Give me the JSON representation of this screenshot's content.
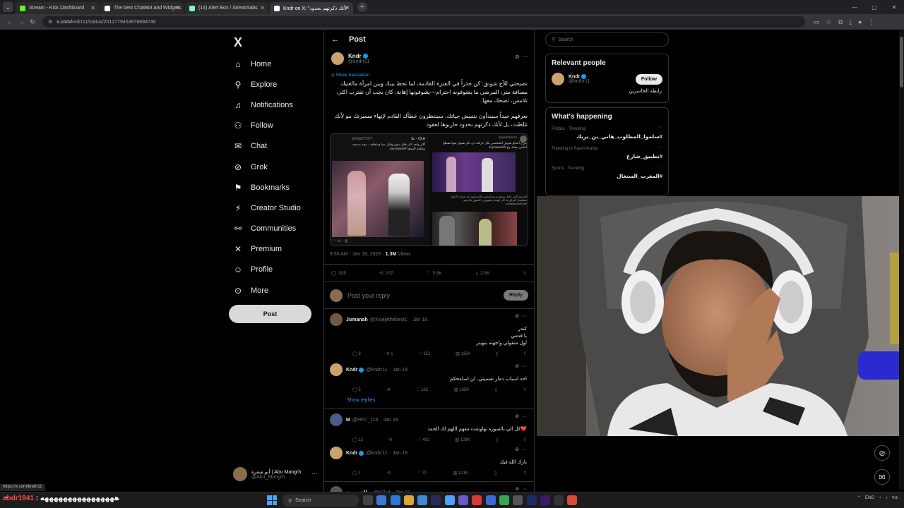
{
  "browser": {
    "tabs": [
      {
        "label": "Stream - Kick Dashboard",
        "color": "#53fc18",
        "icon": "kick-icon",
        "active": false
      },
      {
        "label": "The best ChatBot and Widgets",
        "color": "#ffffff",
        "icon": "botrix-icon",
        "active": false
      },
      {
        "label": "(14) Alert Box / Streamlabs",
        "color": "#80f5d2",
        "icon": "streamlabs-icon",
        "active": false
      },
      {
        "label": "Kndr on X: \"لأنك ذكرتهم بحدود\"",
        "color": "#ffffff",
        "icon": "x-icon",
        "active": true
      }
    ],
    "url_host": "x.com",
    "url_path": "/kndrr11/status/2012779453878894746"
  },
  "sidebar": {
    "logo": "X",
    "items": [
      {
        "label": "Home",
        "icon": "home-icon",
        "glyph": "⌂"
      },
      {
        "label": "Explore",
        "icon": "search-icon",
        "glyph": "⚲"
      },
      {
        "label": "Notifications",
        "icon": "bell-icon",
        "glyph": "♫"
      },
      {
        "label": "Follow",
        "icon": "person-add-icon",
        "glyph": "⚇"
      },
      {
        "label": "Chat",
        "icon": "mail-icon",
        "glyph": "✉"
      },
      {
        "label": "Grok",
        "icon": "grok-icon",
        "glyph": "⊘"
      },
      {
        "label": "Bookmarks",
        "icon": "bookmark-icon",
        "glyph": "⚑"
      },
      {
        "label": "Creator Studio",
        "icon": "bolt-icon",
        "glyph": "⚡"
      },
      {
        "label": "Communities",
        "icon": "people-icon",
        "glyph": "⚯"
      },
      {
        "label": "Premium",
        "icon": "x-premium-icon",
        "glyph": "✕"
      },
      {
        "label": "Profile",
        "icon": "profile-icon",
        "glyph": "☺"
      },
      {
        "label": "More",
        "icon": "more-circle-icon",
        "glyph": "⊙"
      }
    ],
    "post_label": "Post",
    "account": {
      "name": "أبو منقرة | Abu Mangrh",
      "handle": "@Abu_Mangrh"
    }
  },
  "post": {
    "header": "Post",
    "author": {
      "name": "Kndr",
      "handle": "@kndrr11"
    },
    "show_translation": "Show translation",
    "text_p1": "نصيحتي للأخ شوتق: كن حذراً في الفترة القادمة، لما تحط بينك وبين امرأة مالعنيك مسافة متر، المرضى ما يشوفونه احترام—يشوفونها إهانة، كان يجب أن تقترب اكثر، تلامس، تضحك معها..",
    "text_p2": "نعرفهم جيداً سيبدأون بتنبيش حياتك، سينتظرون خطأك القادم لإنهاء مسيرتك مو لأنك غلطت، بل لأنك ذكرتهم بحدود حاربوها لعقود",
    "media": {
      "embedded_name": "OLA - غلا",
      "embedded_handle": "@Ola977977",
      "embedded_text": "أكثر واحد كان قليل ذوق وقليل حيا ومتخلف.. محد ينصحه ويعلمه السنع! #JoyAwards",
      "second_handle": "@pelectricsn",
      "second_text": "مزاح أسابع شوتق الشخصي بكل حركته ذي دام يسوي فيها مقطع أحلص بيفتك وع #JoyAwards",
      "third_text": "المذيعه اللي حاول يصبح مرتبه القتاص بالحساسيه ان حجاب الأعياد مسلسل العراق ما كان لهقدم لشوتق ن الشوق بالرئيس #JoyAwards2026"
    },
    "meta_time": "9:50 AM · Jan 18, 2026 · ",
    "meta_views": "1.3M",
    "meta_views_label": " Views",
    "stats": {
      "replies": "335",
      "reposts": "237",
      "likes": "5.8K",
      "bookmarks": "2.8K"
    },
    "reply_placeholder": "Post your reply",
    "reply_button": "Reply"
  },
  "comments": [
    {
      "name": "Jumanah",
      "handle": "@Xxjejethebest1",
      "date": "· Jan 18",
      "lines": [
        "كندر",
        "يا قدمي",
        "اول منقولي واجهته بتويتر"
      ],
      "replies": "8",
      "reposts": "1",
      "likes": "151",
      "views": "115K",
      "avatar": "#6b5a4b"
    },
    {
      "name": "Kndr",
      "handle": "@kndrr11",
      "date": "· Jan 18",
      "lines": [
        "احد اسباب دمار نفسيتي، لن اسامحكم"
      ],
      "replies": "5",
      "reposts": "",
      "likes": "182",
      "views": "105K",
      "avatar": "#c9a36b",
      "verified": true
    },
    {
      "name": "M",
      "handle": "@HFC_116",
      "date": "· Jan 18",
      "lines": [
        "❤️كل الي بالصوره تهاوشت معهم اللهم لك الحمد"
      ],
      "replies": "12",
      "reposts": "",
      "likes": "402",
      "views": "129K",
      "avatar": "#4b5a8a"
    },
    {
      "name": "Kndr",
      "handle": "@kndrr11",
      "date": "· Jan 18",
      "lines": [
        "بارك الله فيك"
      ],
      "replies": "1",
      "reposts": "",
      "likes": "70",
      "views": "121K",
      "avatar": "#c9a36b",
      "verified": true
    },
    {
      "name": "حالة حرجة",
      "handle": "@z21of",
      "date": "· Jan 18",
      "lines": [],
      "avatar": "#555555"
    }
  ],
  "show_replies": "Show replies",
  "right": {
    "search_placeholder": "Search",
    "relevant_title": "Relevant people",
    "person": {
      "name": "Kndr",
      "handle": "@kndrr11",
      "bio": "رابطة الخاسرين",
      "follow": "Follow"
    },
    "happening_title": "What's happening",
    "trends": [
      {
        "category": "Politics · Trending",
        "tag": "#سلموا_المطلوب_هاني_بن_بريك"
      },
      {
        "category": "Trending in Saudi Arabia",
        "tag": "#تطبيق_شارع"
      },
      {
        "category": "Sports · Trending",
        "tag": "#المغرب_السنغال"
      }
    ]
  },
  "overlay": {
    "status_url": "https://x.com/kndrr11",
    "chat_user": "abdr1941",
    "chat_msg": ": ههههههههههههههههه"
  },
  "taskbar": {
    "search": "Search",
    "lang": "ENG",
    "time": "٩:٥٠"
  },
  "colors": {
    "accent": "#1d9bf0",
    "background": "#000000",
    "border": "#2f3336"
  }
}
